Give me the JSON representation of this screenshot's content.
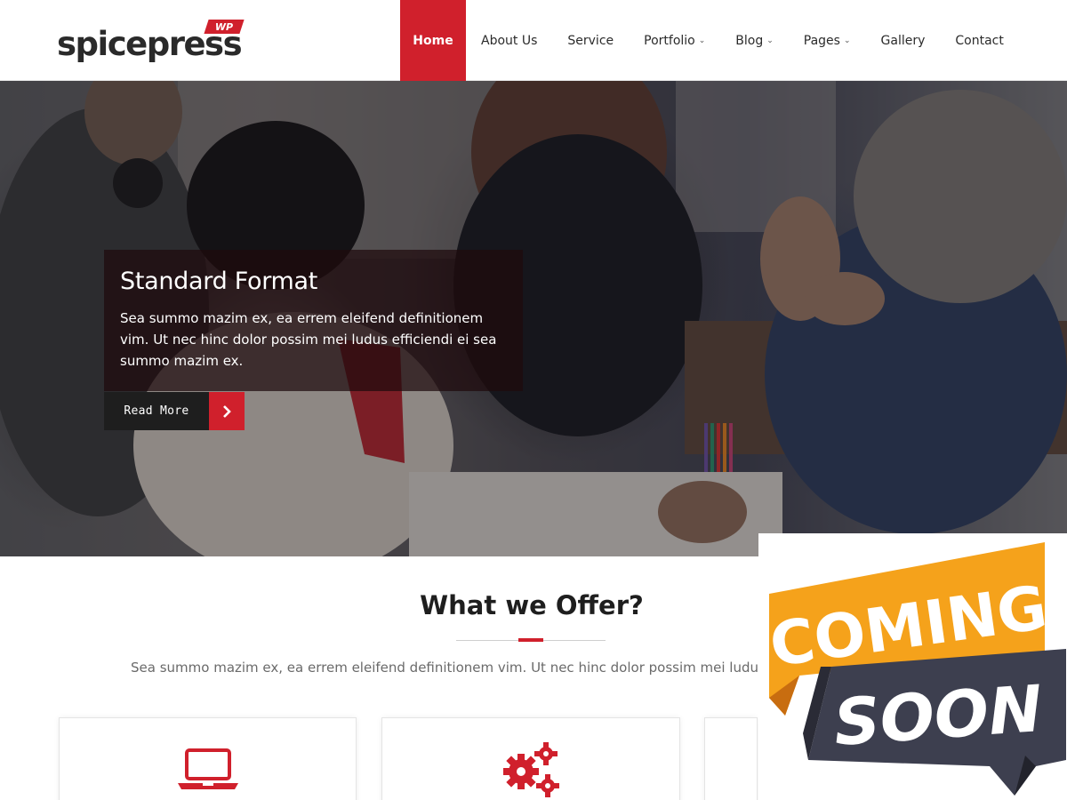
{
  "brand": {
    "name": "spicepress",
    "badge": "WP",
    "accent_color": "#d0202c"
  },
  "nav": {
    "items": [
      {
        "label": "Home",
        "active": true,
        "has_dropdown": false
      },
      {
        "label": "About Us",
        "active": false,
        "has_dropdown": false
      },
      {
        "label": "Service",
        "active": false,
        "has_dropdown": false
      },
      {
        "label": "Portfolio",
        "active": false,
        "has_dropdown": true
      },
      {
        "label": "Blog",
        "active": false,
        "has_dropdown": true
      },
      {
        "label": "Pages",
        "active": false,
        "has_dropdown": true
      },
      {
        "label": "Gallery",
        "active": false,
        "has_dropdown": false
      },
      {
        "label": "Contact",
        "active": false,
        "has_dropdown": false
      }
    ],
    "caret_icon": "chevron-down-icon"
  },
  "hero": {
    "title": "Standard Format",
    "text": "Sea summo mazim ex, ea errem eleifend definitionem vim. Ut nec hinc dolor possim mei ludus efficiendi ei sea summo mazim ex.",
    "button_label": "Read More",
    "button_icon": "chevron-right-icon"
  },
  "offer": {
    "title": "What we Offer?",
    "description": "Sea summo mazim ex, ea errem eleifend definitionem vim. Ut nec hinc dolor possim mei ludus efficiendi ei sea summo mazim ex.",
    "cards": [
      {
        "icon": "laptop-icon"
      },
      {
        "icon": "gears-icon"
      },
      {
        "icon": "unknown"
      }
    ]
  },
  "overlay": {
    "line1": "COMING",
    "line2": "SOON",
    "ribbon_color": "#f5a21b",
    "dark_color": "#3d3f4f"
  }
}
